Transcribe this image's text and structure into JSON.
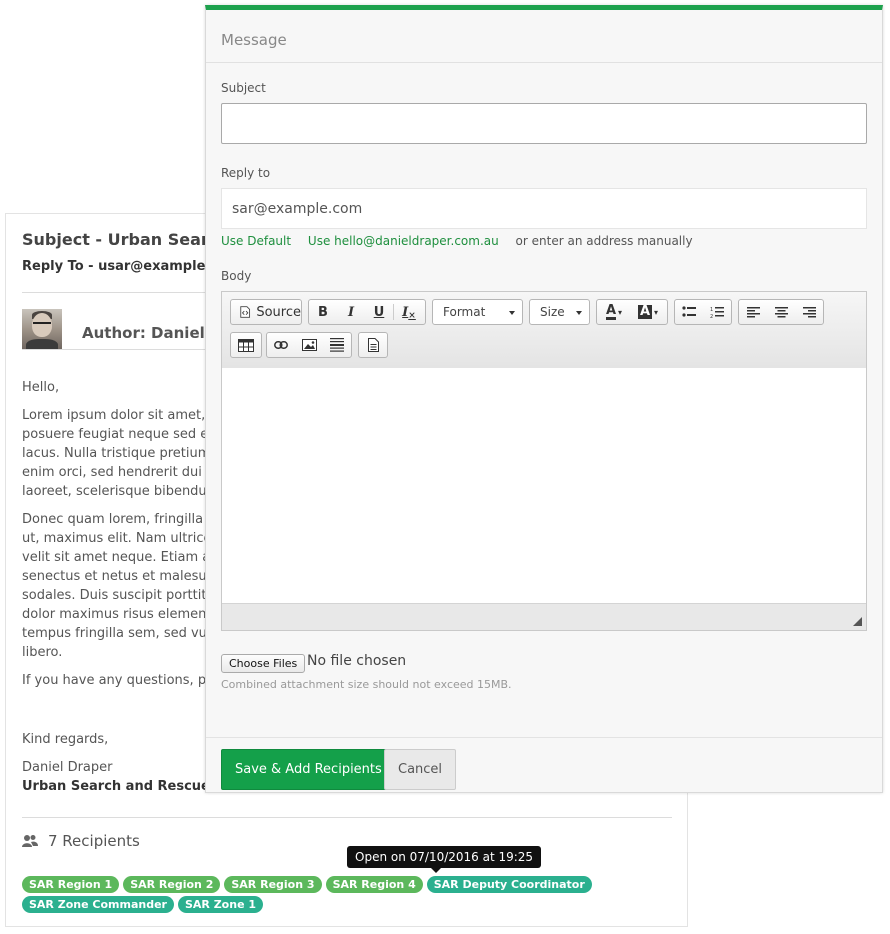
{
  "preview": {
    "subject": "Subject - Urban Search",
    "reply_to": "Reply To - usar@example.co",
    "author": "Author: Daniel D",
    "greeting": "Hello,",
    "paragraphs": [
      [
        "Lorem ipsum dolor sit amet, c",
        "posuere feugiat neque sed eg",
        "lacus. Nulla tristique pretium",
        "enim orci, sed hendrerit dui fa",
        "laoreet, scelerisque bibendum"
      ],
      [
        "Donec quam lorem, fringilla v",
        "ut, maximus elit. Nam ultrices",
        "velit sit amet neque. Etiam ac",
        "senectus et netus et malesuad",
        "sodales. Duis suscipit porttitor",
        "dolor maximus risus elementu",
        "tempus fringilla sem, sed vulp",
        "libero."
      ],
      [
        "If you have any questions, ple"
      ]
    ],
    "closing": "Kind regards,",
    "signature_name": "Daniel Draper",
    "signature_org": "Urban Search and Rescue Co",
    "recipients_label": "7 Recipients",
    "tooltip": "Open on 07/10/2016 at 19:25",
    "recipients": [
      {
        "label": "SAR Region 1",
        "color": "#5cb85c"
      },
      {
        "label": "SAR Region 2",
        "color": "#5cb85c"
      },
      {
        "label": "SAR Region 3",
        "color": "#5cb85c"
      },
      {
        "label": "SAR Region 4",
        "color": "#5cb85c"
      },
      {
        "label": "SAR Deputy Coordinator",
        "color": "#2bb08f"
      },
      {
        "label": "SAR Zone Commander",
        "color": "#2bb08f"
      },
      {
        "label": "SAR Zone 1",
        "color": "#2bb08f"
      }
    ]
  },
  "modal": {
    "title": "Message",
    "subject_label": "Subject",
    "subject_value": "",
    "reply_to_label": "Reply to",
    "reply_to_value": "sar@example.com",
    "use_default_link": "Use Default",
    "use_alt_link": "Use hello@danieldraper.com.au",
    "manual_hint": "or enter an address manually",
    "body_label": "Body",
    "editor": {
      "source_label": "Source",
      "format_label": "Format",
      "size_label": "Size"
    },
    "choose_files_label": "Choose Files",
    "no_file_text": "No file chosen",
    "attachment_help": "Combined attachment size should not exceed 15MB.",
    "save_button": "Save & Add Recipients",
    "cancel_button": "Cancel"
  },
  "colors": {
    "accent": "#1ea24e",
    "primary_button": "#14a04a",
    "link": "#1e8f3e"
  }
}
